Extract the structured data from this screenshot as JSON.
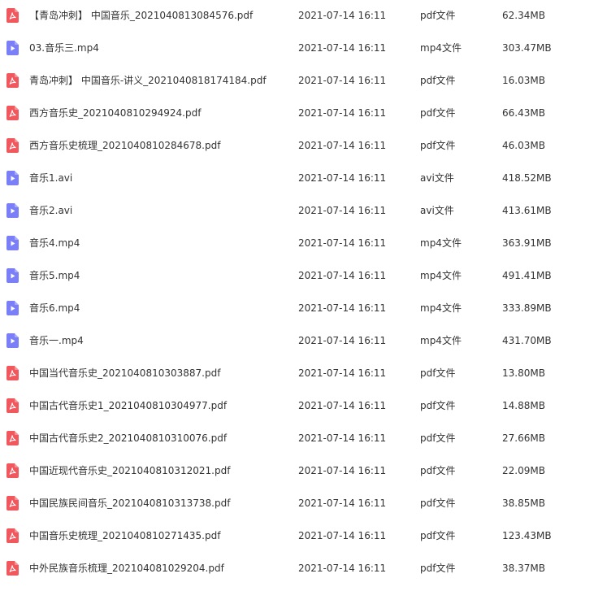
{
  "colors": {
    "pdf_icon": "#f0585e",
    "video_icon": "#7b7ff7",
    "text": "#333333"
  },
  "files": [
    {
      "name": "【青岛冲刺】 中国音乐_2021040813084576.pdf",
      "date": "2021-07-14 16:11",
      "type": "pdf文件",
      "size": "62.34MB",
      "icon": "pdf-icon"
    },
    {
      "name": "03.音乐三.mp4",
      "date": "2021-07-14 16:11",
      "type": "mp4文件",
      "size": "303.47MB",
      "icon": "video-icon"
    },
    {
      "name": "青岛冲刺】 中国音乐-讲义_2021040818174184.pdf",
      "date": "2021-07-14 16:11",
      "type": "pdf文件",
      "size": "16.03MB",
      "icon": "pdf-icon"
    },
    {
      "name": "西方音乐史_2021040810294924.pdf",
      "date": "2021-07-14 16:11",
      "type": "pdf文件",
      "size": "66.43MB",
      "icon": "pdf-icon"
    },
    {
      "name": "西方音乐史梳理_2021040810284678.pdf",
      "date": "2021-07-14 16:11",
      "type": "pdf文件",
      "size": "46.03MB",
      "icon": "pdf-icon"
    },
    {
      "name": "音乐1.avi",
      "date": "2021-07-14 16:11",
      "type": "avi文件",
      "size": "418.52MB",
      "icon": "video-icon"
    },
    {
      "name": "音乐2.avi",
      "date": "2021-07-14 16:11",
      "type": "avi文件",
      "size": "413.61MB",
      "icon": "video-icon"
    },
    {
      "name": "音乐4.mp4",
      "date": "2021-07-14 16:11",
      "type": "mp4文件",
      "size": "363.91MB",
      "icon": "video-icon"
    },
    {
      "name": "音乐5.mp4",
      "date": "2021-07-14 16:11",
      "type": "mp4文件",
      "size": "491.41MB",
      "icon": "video-icon"
    },
    {
      "name": "音乐6.mp4",
      "date": "2021-07-14 16:11",
      "type": "mp4文件",
      "size": "333.89MB",
      "icon": "video-icon"
    },
    {
      "name": "音乐一.mp4",
      "date": "2021-07-14 16:11",
      "type": "mp4文件",
      "size": "431.70MB",
      "icon": "video-icon"
    },
    {
      "name": "中国当代音乐史_2021040810303887.pdf",
      "date": "2021-07-14 16:11",
      "type": "pdf文件",
      "size": "13.80MB",
      "icon": "pdf-icon"
    },
    {
      "name": "中国古代音乐史1_2021040810304977.pdf",
      "date": "2021-07-14 16:11",
      "type": "pdf文件",
      "size": "14.88MB",
      "icon": "pdf-icon"
    },
    {
      "name": "中国古代音乐史2_2021040810310076.pdf",
      "date": "2021-07-14 16:11",
      "type": "pdf文件",
      "size": "27.66MB",
      "icon": "pdf-icon"
    },
    {
      "name": "中国近现代音乐史_2021040810312021.pdf",
      "date": "2021-07-14 16:11",
      "type": "pdf文件",
      "size": "22.09MB",
      "icon": "pdf-icon"
    },
    {
      "name": "中国民族民间音乐_2021040810313738.pdf",
      "date": "2021-07-14 16:11",
      "type": "pdf文件",
      "size": "38.85MB",
      "icon": "pdf-icon"
    },
    {
      "name": "中国音乐史梳理_2021040810271435.pdf",
      "date": "2021-07-14 16:11",
      "type": "pdf文件",
      "size": "123.43MB",
      "icon": "pdf-icon"
    },
    {
      "name": "中外民族音乐梳理_2021040810292​04.pdf",
      "date": "2021-07-14 16:11",
      "type": "pdf文件",
      "size": "38.37MB",
      "icon": "pdf-icon"
    }
  ]
}
